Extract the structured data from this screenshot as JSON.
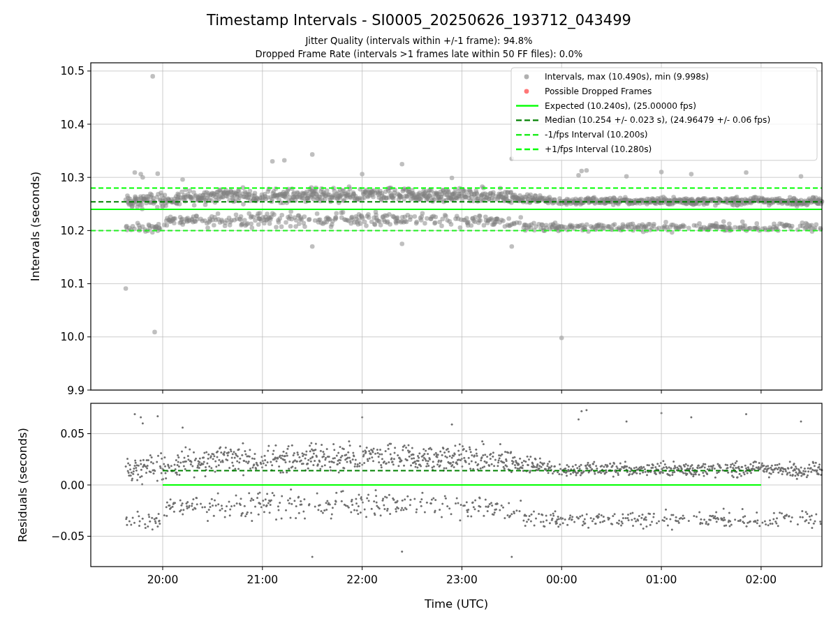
{
  "figure": {
    "title": "Timestamp Intervals - SI0005_20250626_193712_043499",
    "subtitles": [
      "Jitter Quality (intervals within +/-1 frame): 94.8%",
      "Dropped Frame Rate (intervals >1 frames late within 50 FF files): 0.0%"
    ]
  },
  "intervals_panel": {
    "legend_markers": [
      {
        "label": "Intervals, max (10.490s), min (9.998s)",
        "color": "#b0b0b0"
      },
      {
        "label": "Possible Dropped Frames",
        "color": "#ff7777"
      }
    ],
    "chart_data": {
      "type": "line",
      "ylabel": "Intervals (seconds)",
      "grid": true,
      "legend": true,
      "categories": [
        null,
        null,
        null,
        null,
        null,
        null,
        null
      ],
      "ylim": [
        9.9,
        10.5155
      ],
      "yticks": [
        {
          "value": 9.9,
          "label": "9.9"
        },
        {
          "value": 10.0,
          "label": "10.0"
        },
        {
          "value": 10.1,
          "label": "10.1"
        },
        {
          "value": 10.2,
          "label": "10.2"
        },
        {
          "value": 10.3,
          "label": "10.3"
        },
        {
          "value": 10.4,
          "label": "10.4"
        },
        {
          "value": 10.5,
          "label": "10.5"
        }
      ],
      "series": [
        {
          "name": "Expected (10.240s), (25.00000 fps)",
          "color": "#00ff00",
          "line_style": "solid",
          "marker": "none",
          "values": [
            10.24,
            10.24,
            10.24,
            10.24,
            10.24,
            10.24,
            10.24
          ]
        },
        {
          "name": "Median (10.254 +/- 0.023 s), (24.96479 +/- 0.06 fps)",
          "color": "#008000",
          "line_style": "dashed",
          "marker": "none",
          "values": [
            10.254,
            10.254,
            10.254,
            10.254,
            10.254,
            10.254,
            10.254
          ]
        },
        {
          "name": "-1/fps Interval (10.200s)",
          "color": "#22ee22",
          "line_style": "dashed",
          "marker": "none",
          "values": [
            10.2,
            10.2,
            10.2,
            10.2,
            10.2,
            10.2,
            10.2
          ]
        },
        {
          "name": "+1/fps Interval (10.280s)",
          "color": "#00ff00",
          "line_style": "dashed",
          "marker": "none",
          "values": [
            10.28,
            10.28,
            10.28,
            10.28,
            10.28,
            10.28,
            10.28
          ]
        }
      ]
    }
  },
  "residuals_panel": {
    "chart_data": {
      "type": "line",
      "xlabel": "Time (UTC)",
      "ylabel": "Residuals (seconds)",
      "grid": true,
      "categories": [
        "20:00",
        "21:00",
        "22:00",
        "23:00",
        "00:00",
        "01:00",
        "02:00"
      ],
      "ylim": [
        -0.0796,
        0.0796
      ],
      "yticks": [
        {
          "value": -0.05,
          "label": "−0.05"
        },
        {
          "value": 0,
          "label": "0.00"
        },
        {
          "value": 0.05,
          "label": "0.05"
        }
      ],
      "series": [
        {
          "color": "#008000",
          "line_style": "dashed",
          "marker": "none",
          "values": [
            0.014,
            0.014,
            0.014,
            0.014,
            0.014,
            0.014,
            0.014
          ]
        },
        {
          "color": "#00ff00",
          "line_style": "solid",
          "marker": "none",
          "values": [
            0,
            0,
            0,
            0,
            0,
            0,
            0
          ]
        }
      ]
    }
  }
}
